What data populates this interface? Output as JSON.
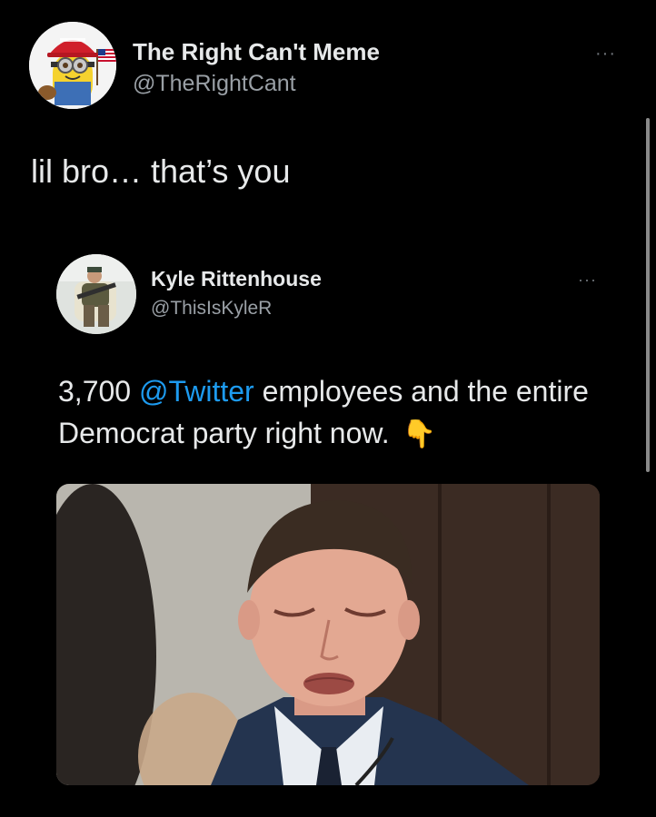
{
  "outer_tweet": {
    "display_name": "The Right Can't Meme",
    "handle": "@TheRightCant",
    "more_label": "···",
    "text": "lil bro… that’s you",
    "avatar_icon": "minion-avatar-icon"
  },
  "quoted_tweet": {
    "display_name": "Kyle Rittenhouse",
    "handle": "@ThisIsKyleR",
    "more_label": "···",
    "text_before": "3,700 ",
    "mention": "@Twitter",
    "text_after": " employees and the entire Democrat party right now.",
    "emoji": "👇",
    "avatar_icon": "man-seated-avatar-icon",
    "media": "crying-man-photo"
  },
  "colors": {
    "background": "#000000",
    "text": "#e7e9ea",
    "secondary": "#9aa0a6",
    "mention": "#1d9bf0"
  }
}
